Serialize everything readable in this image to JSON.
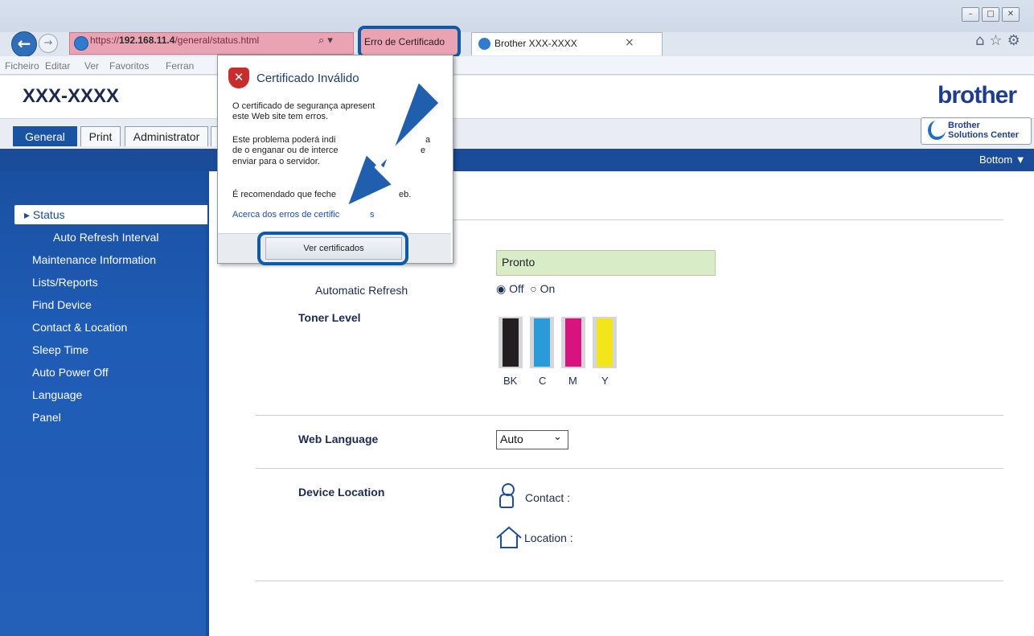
{
  "browser": {
    "address_prefix": "https://",
    "address_host": "192.168.11.4",
    "address_path": "/general/status.html",
    "search_glyph": "⌕ ▾",
    "cert_error_tab": "Erro de Certificado",
    "tab_title": "Brother XXX-XXXX",
    "tab_close": "×",
    "toolbar_icons": "⌂☆⚙",
    "window_controls": [
      "–",
      "□",
      "✕"
    ],
    "menu": [
      "Ficheiro",
      "Editar",
      "Ver",
      "Favoritos",
      "Ferran"
    ]
  },
  "header": {
    "model": "XXX-XXXX",
    "brand": "brother",
    "solutions_line1": "Brother",
    "solutions_line2": "Solutions Center"
  },
  "tabs": [
    "General",
    "Print",
    "Administrator"
  ],
  "bottom_link": "Bottom ▼",
  "sidebar": {
    "items": [
      {
        "label": "▸ Status",
        "active": true
      },
      {
        "label": "Auto Refresh Interval"
      },
      {
        "label": "Maintenance Information"
      },
      {
        "label": "Lists/Reports"
      },
      {
        "label": "Find Device"
      },
      {
        "label": "Contact & Location"
      },
      {
        "label": "Sleep Time"
      },
      {
        "label": "Auto Power Off"
      },
      {
        "label": "Language"
      },
      {
        "label": "Panel"
      }
    ]
  },
  "main": {
    "status_value": "Pronto",
    "auto_refresh_label": "Automatic Refresh",
    "radio_off": "Off",
    "radio_on": "On",
    "radio_selected": "Off",
    "toner_label": "Toner Level",
    "toner": [
      {
        "name": "BK",
        "color": "#231f20"
      },
      {
        "name": "C",
        "color": "#2a9bd8"
      },
      {
        "name": "M",
        "color": "#d8137f"
      },
      {
        "name": "Y",
        "color": "#f2e51c"
      }
    ],
    "web_language_label": "Web Language",
    "web_language_value": "Auto",
    "device_location_label": "Device Location",
    "contact_label": "Contact :",
    "location_label": "Location :"
  },
  "popup": {
    "title": "Certificado Inválido",
    "line1": "O certificado de segurança apresent",
    "line2": "este Web site tem erros.",
    "line3": "Este problema poderá indi",
    "line3b": "a",
    "line4": "de o enganar ou de interce",
    "line4b": "e",
    "line5": "enviar para o servidor.",
    "line6": "É recomendado que feche",
    "line6b": "eb.",
    "link": "Acerca dos erros de certific",
    "link_b": "s",
    "button": "Ver certificados"
  },
  "colors": {
    "brand_blue": "#1a4c99",
    "highlight_blue": "#0d5aa9",
    "status_green": "#d9ecc8",
    "cert_error_pink": "#e9a3b3"
  }
}
